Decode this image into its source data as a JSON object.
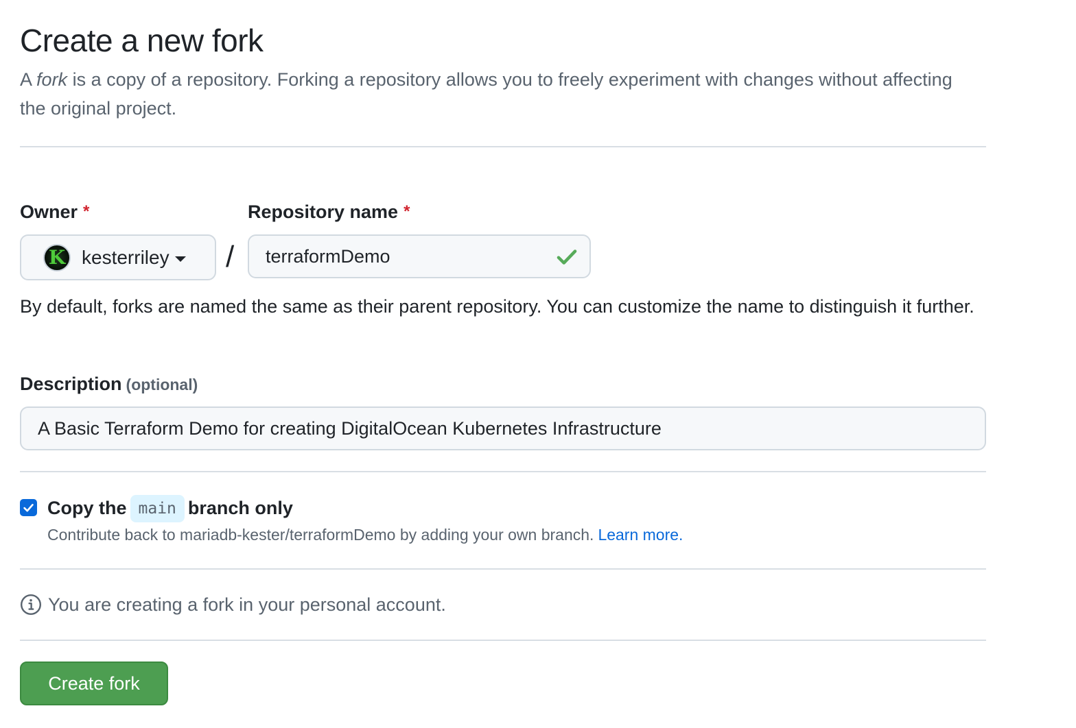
{
  "header": {
    "title": "Create a new fork",
    "subtitle_prefix": "A",
    "subtitle_em": "fork",
    "subtitle_rest": "is a copy of a repository. Forking a repository allows you to freely experiment with changes without affecting the original project."
  },
  "owner": {
    "label": "Owner",
    "required_marker": "*",
    "selected": "kesterriley",
    "avatar_letter": "K"
  },
  "separator": "/",
  "repository": {
    "label": "Repository name",
    "required_marker": "*",
    "value": "terraformDemo",
    "status": "valid",
    "status_color": "#57ab5a",
    "help_text": "By default, forks are named the same as their parent repository. You can customize the name to distinguish it further."
  },
  "description": {
    "label": "Description",
    "optional_text": "(optional)",
    "value": "A Basic Terraform Demo for creating DigitalOcean Kubernetes Infrastructure"
  },
  "copy_branch": {
    "checked": true,
    "label_before": "Copy the",
    "branch": "main",
    "label_after": "branch only",
    "sub_text": "Contribute back to mariadb-kester/terraformDemo by adding your own branch.",
    "link_text": "Learn more."
  },
  "info": {
    "icon": "info-icon",
    "text": "You are creating a fork in your personal account."
  },
  "actions": {
    "create_label": "Create fork",
    "create_color": "#4d9e51"
  },
  "colors": {
    "accent": "#0969da",
    "required": "#d1242f",
    "muted_text": "#59636e"
  }
}
